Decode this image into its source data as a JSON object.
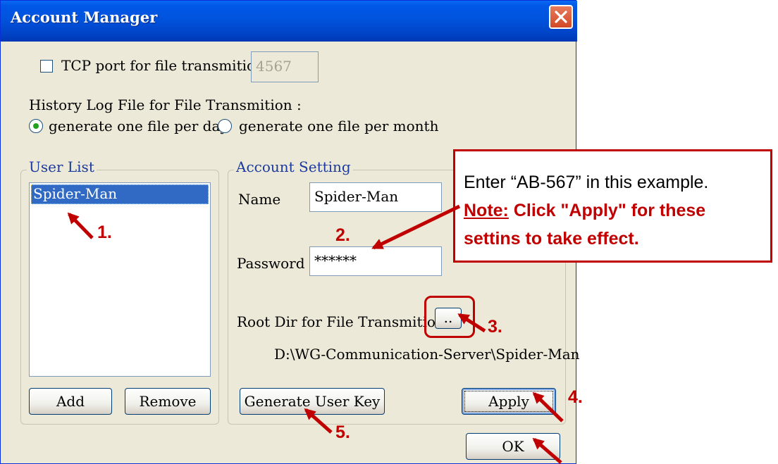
{
  "window": {
    "title": "Account Manager"
  },
  "tcp": {
    "label": "TCP port for file transmition",
    "checked": false,
    "value": "4567"
  },
  "history": {
    "label": "History Log File for File Transmition :",
    "options": [
      {
        "label": "generate one file per day",
        "selected": true
      },
      {
        "label": "generate one file per month",
        "selected": false
      }
    ]
  },
  "user_list": {
    "title": "User List",
    "items": [
      "Spider-Man"
    ],
    "add_label": "Add",
    "remove_label": "Remove"
  },
  "account": {
    "title": "Account Setting",
    "name_label": "Name",
    "name_value": "Spider-Man",
    "password_label": "Password",
    "password_value": "******",
    "root_dir_label": "Root Dir for File Transmition",
    "browse_label": "..",
    "root_dir_path": "D:\\WG-Communication-Server\\Spider-Man",
    "gen_key_label": "Generate User Key",
    "apply_label": "Apply"
  },
  "ok_label": "OK",
  "annotation": {
    "callout_line1": "Enter “AB-567” in this example.",
    "callout_note_prefix": "Note:",
    "callout_note_rest": " Click \"Apply\" for these",
    "callout_line3": "settins to take effect.",
    "steps": [
      "1.",
      "2.",
      "3.",
      "4.",
      "5."
    ],
    "color": "#c00000"
  },
  "colors": {
    "title_bar": "#0054e3",
    "dialog_bg": "#ece9d8",
    "selection": "#316ac5"
  }
}
